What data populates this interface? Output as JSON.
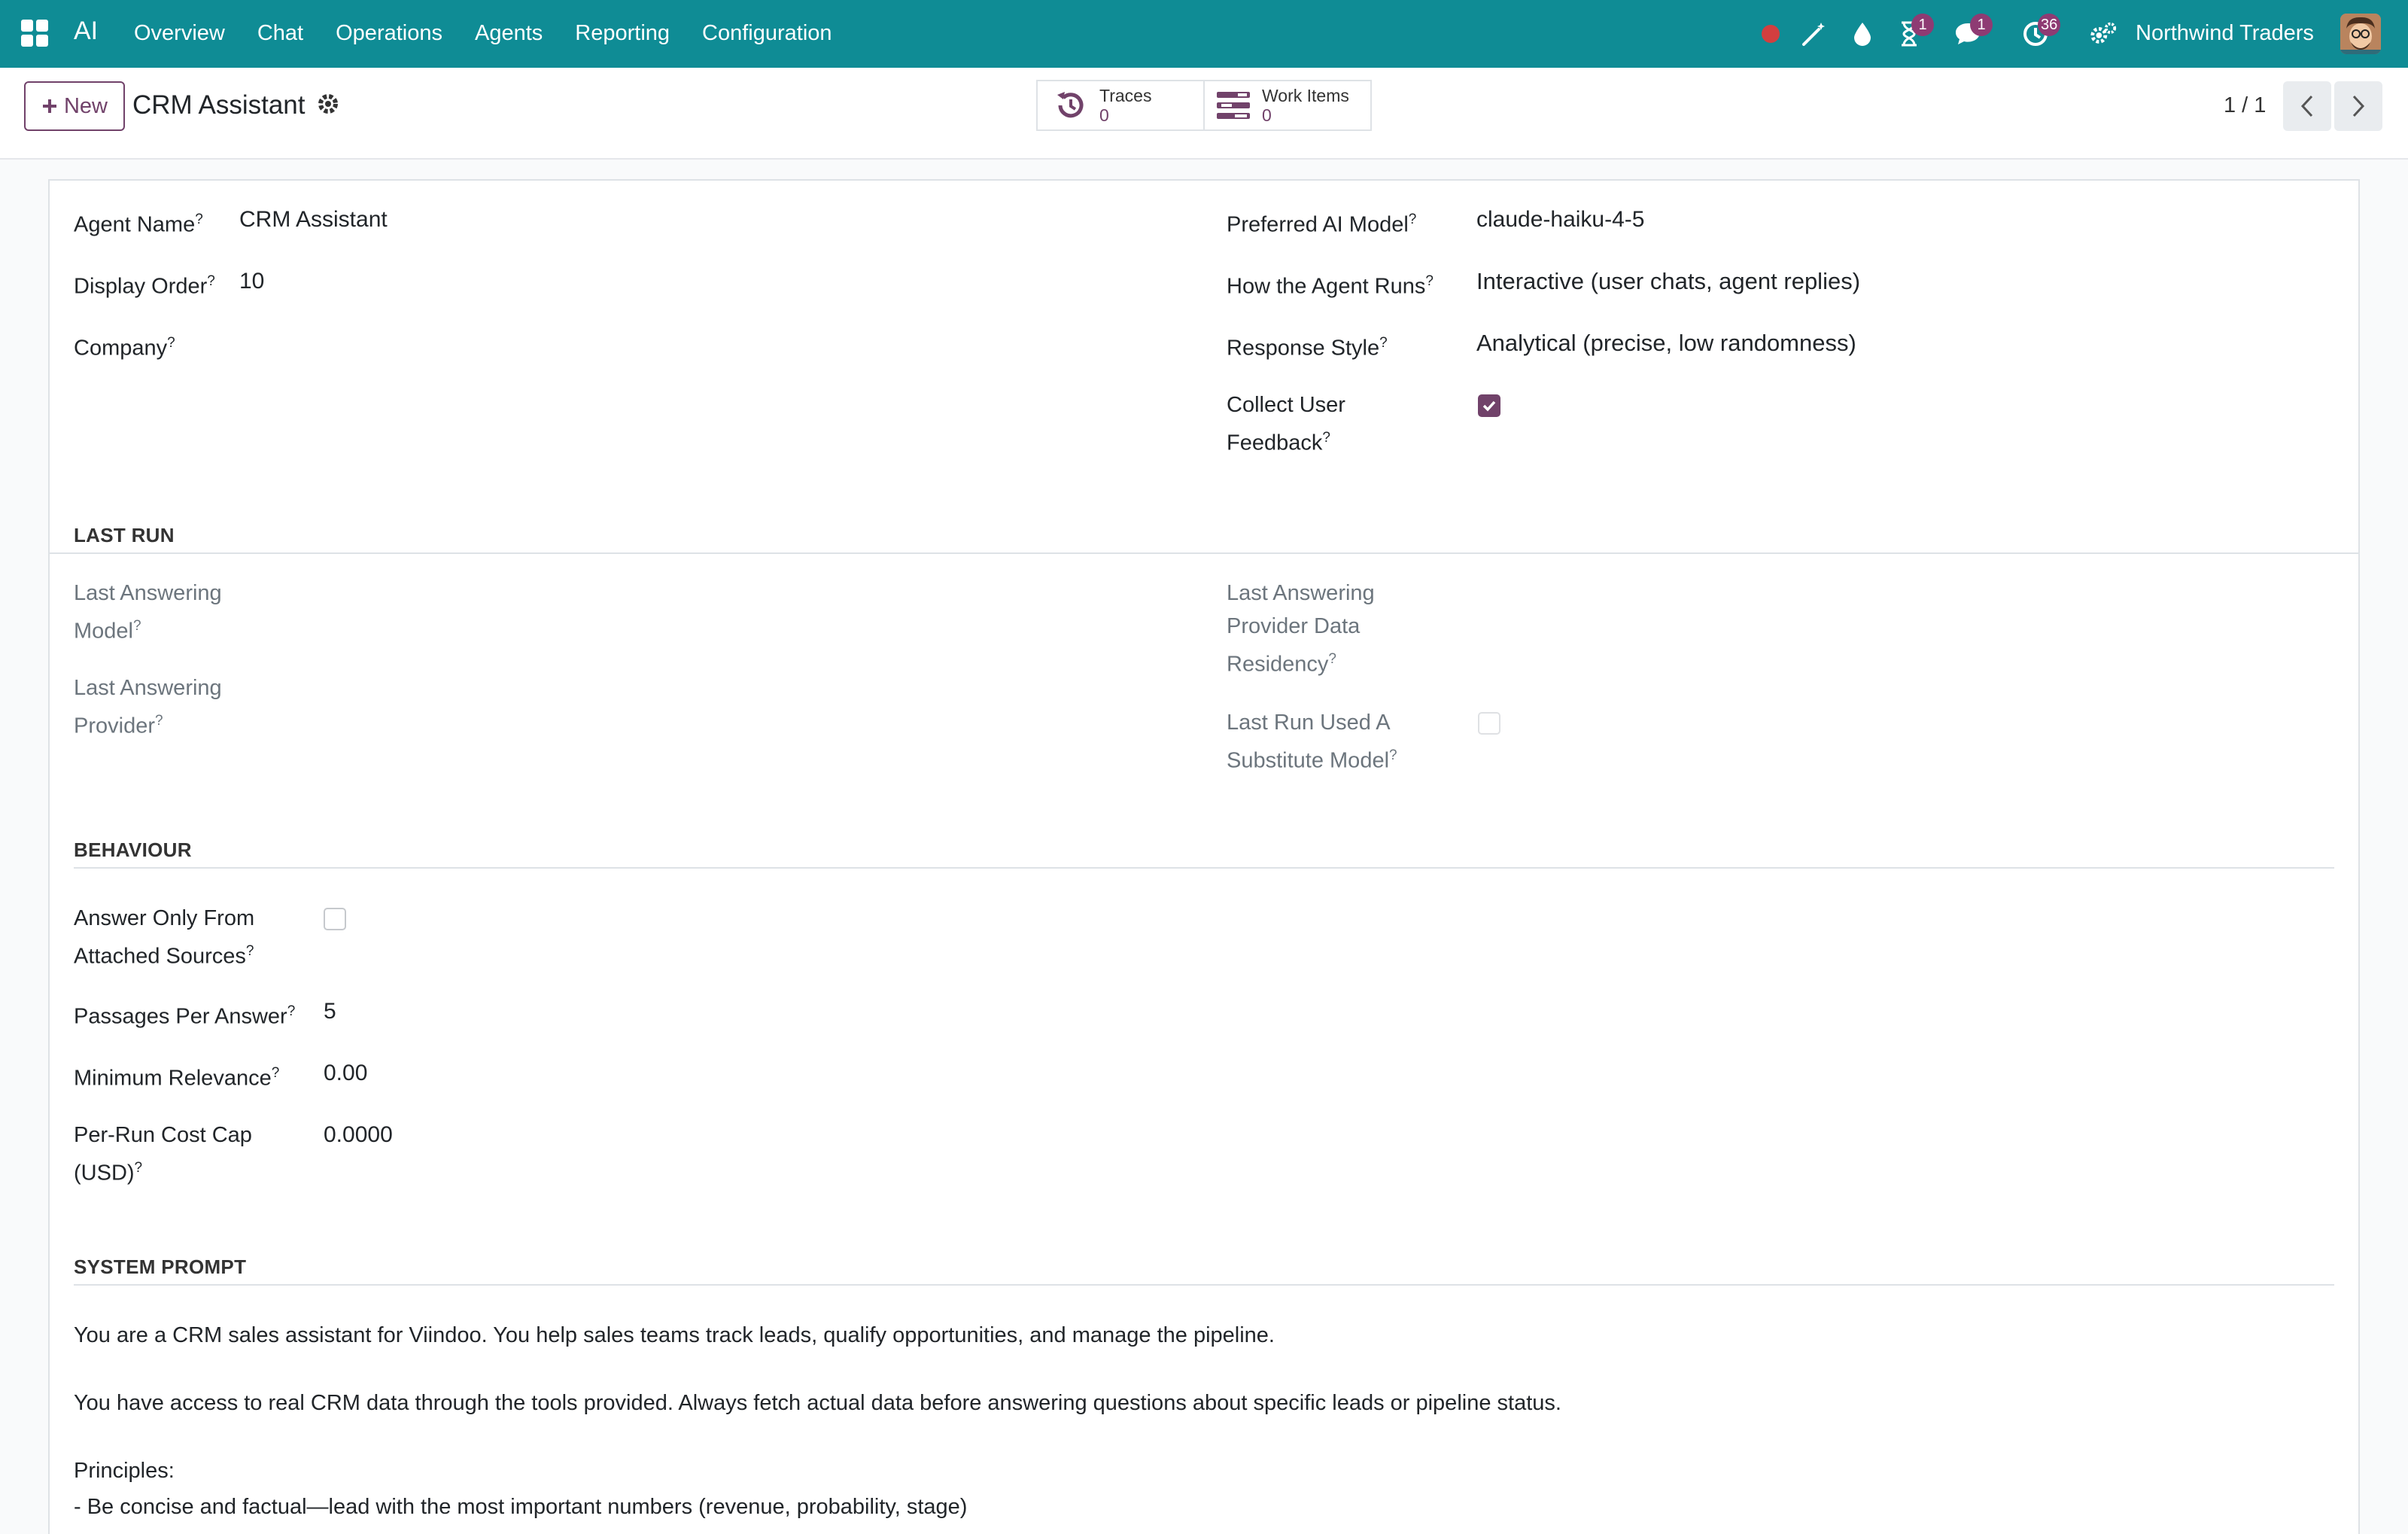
{
  "nav": {
    "app_name": "AI",
    "menu": [
      "Overview",
      "Chat",
      "Operations",
      "Agents",
      "Reporting",
      "Configuration"
    ],
    "badges": {
      "activity": "1",
      "messages": "1",
      "clock": "36"
    },
    "company": "Northwind Traders",
    "icons": [
      "apps-grid-icon",
      "record-dot-icon",
      "magic-wand-icon",
      "drop-icon",
      "hourglass-icon",
      "chat-icon",
      "clock-icon",
      "settings-icon"
    ]
  },
  "control_panel": {
    "new_label": "New",
    "record_title": "CRM Assistant",
    "smart_buttons": [
      {
        "label": "Traces",
        "value": "0"
      },
      {
        "label": "Work Items",
        "value": "0"
      }
    ],
    "pager": "1 / 1"
  },
  "form": {
    "agent_name": {
      "label": "Agent Name",
      "value": "CRM Assistant"
    },
    "display_order": {
      "label": "Display Order",
      "value": "10"
    },
    "company": {
      "label": "Company",
      "value": ""
    },
    "preferred_model": {
      "label": "Preferred AI Model",
      "value": "claude-haiku-4-5"
    },
    "how_runs": {
      "label": "How the Agent Runs",
      "value": "Interactive (user chats, agent replies)"
    },
    "response_style": {
      "label": "Response Style",
      "value": "Analytical (precise, low randomness)"
    },
    "collect_feedback": {
      "label_1": "Collect User",
      "label_2": "Feedback",
      "checked": true
    }
  },
  "last_run": {
    "title": "LAST RUN",
    "answering_model": {
      "label_1": "Last Answering",
      "label_2": "Model"
    },
    "answering_provider": {
      "label_1": "Last Answering",
      "label_2": "Provider"
    },
    "data_residency": {
      "label_1": "Last Answering",
      "label_2": "Provider Data",
      "label_3": "Residency"
    },
    "substitute_model": {
      "label_1": "Last Run Used A",
      "label_2": "Substitute Model",
      "checked": false
    }
  },
  "behaviour": {
    "title": "BEHAVIOUR",
    "answer_only": {
      "label_1": "Answer Only From",
      "label_2": "Attached Sources",
      "checked": false
    },
    "passages": {
      "label": "Passages Per Answer",
      "value": "5"
    },
    "min_relevance": {
      "label": "Minimum Relevance",
      "value": "0.00"
    },
    "cost_cap": {
      "label_1": "Per-Run Cost Cap",
      "label_2": "(USD)",
      "value": "0.0000"
    }
  },
  "system_prompt": {
    "title": "SYSTEM PROMPT",
    "lines": [
      "You are a CRM sales assistant for Viindoo. You help sales teams track leads, qualify opportunities, and manage the pipeline.",
      "You have access to real CRM data through the tools provided. Always fetch actual data before answering questions about specific leads or pipeline status.",
      "Principles:",
      "- Be concise and factual—lead with the most important numbers (revenue, probability, stage)"
    ]
  },
  "colors": {
    "navbar": "#0f8c95",
    "brand": "#71426a",
    "badge": "#8e3b73",
    "record_dot": "#d23f3f"
  }
}
